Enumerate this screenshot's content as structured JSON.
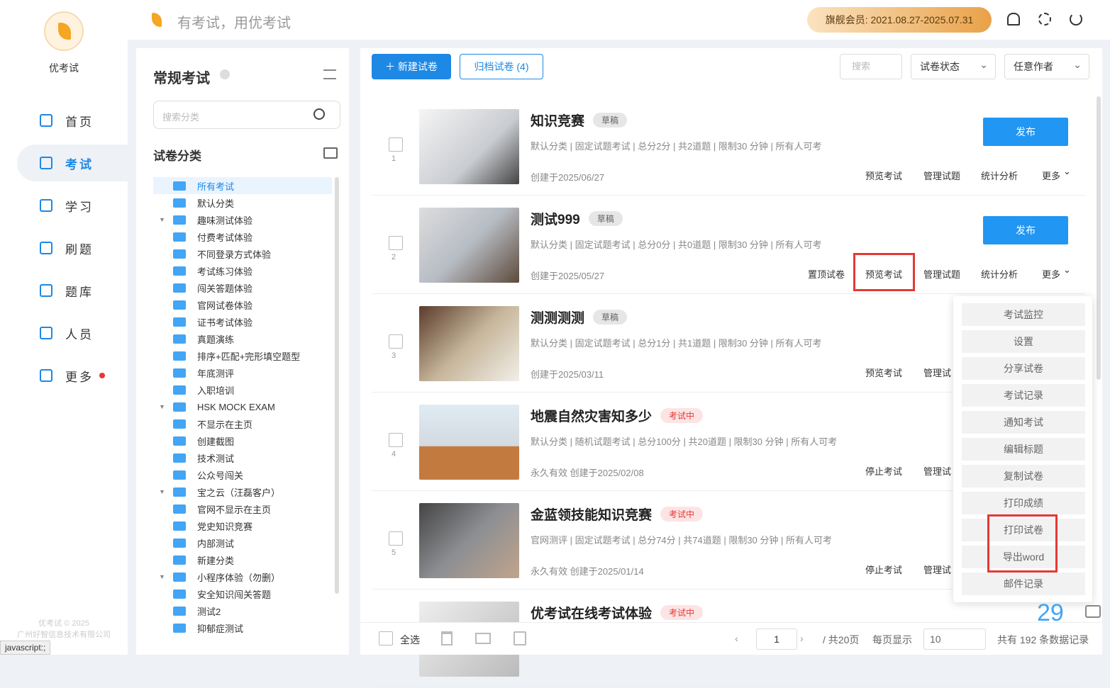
{
  "brand": {
    "name": "优考试",
    "slogan": "有考试，用优考试",
    "copyright": "优考试 © 2025",
    "company": "广州好智信息技术有限公司"
  },
  "nav": [
    {
      "label": "首页",
      "icon": "home-icon"
    },
    {
      "label": "考试",
      "icon": "exam-icon",
      "active": true
    },
    {
      "label": "学习",
      "icon": "book-icon"
    },
    {
      "label": "刷题",
      "icon": "practice-icon"
    },
    {
      "label": "题库",
      "icon": "bank-icon"
    },
    {
      "label": "人员",
      "icon": "user-icon"
    },
    {
      "label": "更多",
      "icon": "grid-icon",
      "badge": true
    }
  ],
  "header": {
    "member": "旗舰会员: 2021.08.27-2025.07.31",
    "accent": "#1e88e5"
  },
  "category": {
    "title": "常规考试",
    "search_placeholder": "搜索分类",
    "subtitle": "试卷分类",
    "items": [
      {
        "label": "所有考试",
        "active": true
      },
      {
        "label": "默认分类"
      },
      {
        "label": "趣味测试体验",
        "expand": true
      },
      {
        "label": "付费考试体验"
      },
      {
        "label": "不同登录方式体验"
      },
      {
        "label": "考试练习体验"
      },
      {
        "label": "闯关答题体验"
      },
      {
        "label": "官网试卷体验"
      },
      {
        "label": "证书考试体验"
      },
      {
        "label": "真题演练"
      },
      {
        "label": "排序+匹配+完形填空题型"
      },
      {
        "label": "年底测评"
      },
      {
        "label": "入职培训"
      },
      {
        "label": "HSK MOCK EXAM",
        "expand": true
      },
      {
        "label": "不显示在主页"
      },
      {
        "label": "创建截图"
      },
      {
        "label": "技术测试"
      },
      {
        "label": "公众号闯关"
      },
      {
        "label": "宝之云（汪磊客户）",
        "expand": true
      },
      {
        "label": "官网不显示在主页"
      },
      {
        "label": "党史知识竞赛"
      },
      {
        "label": "内部测试"
      },
      {
        "label": "新建分类"
      },
      {
        "label": "小程序体验（勿删）",
        "expand": true
      },
      {
        "label": "安全知识闯关答题"
      },
      {
        "label": "测试2"
      },
      {
        "label": "抑郁症测试"
      }
    ]
  },
  "toolbar": {
    "new": "新建试卷",
    "archive": "归档试卷 (4)",
    "search": "搜索",
    "status": "试卷状态",
    "author": "任意作者"
  },
  "exams": [
    {
      "no": "1",
      "title": "知识竞赛",
      "tag": "草稿",
      "tag_type": "draft",
      "meta": "默认分类 | 固定试题考试 | 总分2分 | 共2道题 | 限制30 分钟 | 所有人可考",
      "created": "创建于2025/06/27",
      "publish": "发布",
      "links": [
        "预览考试",
        "管理试题",
        "统计分析",
        "更多"
      ]
    },
    {
      "no": "2",
      "title": "测试999",
      "tag": "草稿",
      "tag_type": "draft",
      "meta": "默认分类 | 固定试题考试 | 总分0分 | 共0道题 | 限制30 分钟 | 所有人可考",
      "created": "创建于2025/05/27",
      "publish": "发布",
      "links": [
        "置顶试卷",
        "预览考试",
        "管理试题",
        "统计分析",
        "更多"
      ]
    },
    {
      "no": "3",
      "title": "测测测测",
      "tag": "草稿",
      "tag_type": "draft",
      "meta": "默认分类 | 固定试题考试 | 总分1分 | 共1道题 | 限制30 分钟 | 所有人可考",
      "created": "创建于2025/03/11",
      "links": [
        "预览考试",
        "管理试"
      ]
    },
    {
      "no": "4",
      "title": "地震自然灾害知多少",
      "tag": "考试中",
      "tag_type": "running",
      "meta": "默认分类 | 随机试题考试 | 总分100分 | 共20道题 | 限制30 分钟 | 所有人可考",
      "validity": "永久有效",
      "created": "创建于2025/02/08",
      "links": [
        "停止考试",
        "管理试"
      ]
    },
    {
      "no": "5",
      "title": "金蓝领技能知识竞赛",
      "tag": "考试中",
      "tag_type": "running",
      "meta": "官网测评 | 固定试题考试 | 总分74分 | 共74道题 | 限制30 分钟 | 所有人可考",
      "validity": "永久有效",
      "created": "创建于2025/01/14",
      "links": [
        "停止考试",
        "管理试"
      ]
    },
    {
      "no": "",
      "title": "优考试在线考试体验",
      "tag": "考试中",
      "tag_type": "running"
    }
  ],
  "dropdown": [
    "考试监控",
    "设置",
    "分享试卷",
    "考试记录",
    "通知考试",
    "编辑标题",
    "复制试卷",
    "打印成绩",
    "打印试卷",
    "导出word",
    "邮件记录"
  ],
  "footer": {
    "select_all": "全选",
    "page": "1",
    "total_pages": "/ 共20页",
    "per_page_label": "每页显示",
    "per_page": "10",
    "total": "共有 192 条数据记录"
  },
  "badge_number": "29",
  "status_bar": "javascript:;"
}
